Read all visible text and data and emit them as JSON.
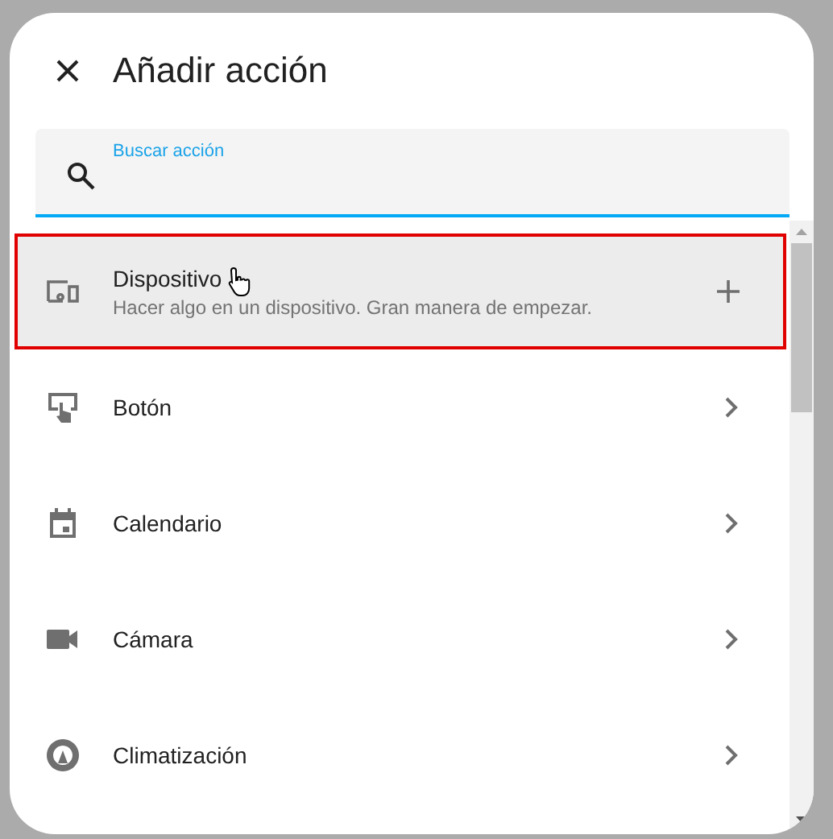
{
  "dialog": {
    "title": "Añadir acción"
  },
  "search": {
    "placeholder": "Buscar acción"
  },
  "items": [
    {
      "label": "Dispositivo",
      "description": "Hacer algo en un dispositivo. Gran manera de empezar.",
      "kind": "add",
      "selected": true
    },
    {
      "label": "Botón",
      "kind": "chevron",
      "selected": false
    },
    {
      "label": "Calendario",
      "kind": "chevron",
      "selected": false
    },
    {
      "label": "Cámara",
      "kind": "chevron",
      "selected": false
    },
    {
      "label": "Climatización",
      "kind": "chevron",
      "selected": false
    }
  ]
}
